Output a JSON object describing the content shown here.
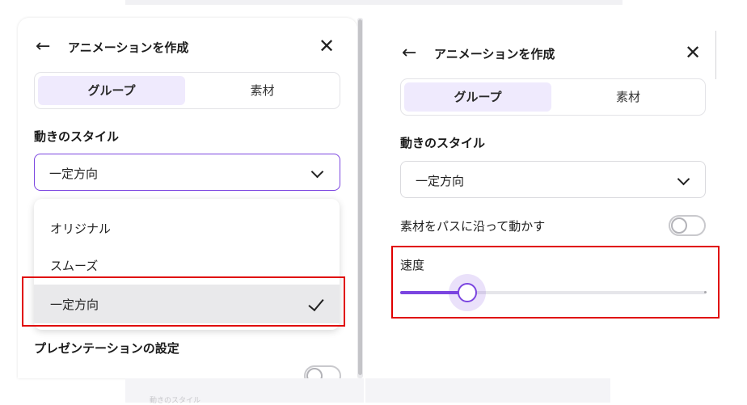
{
  "left_panel": {
    "header": {
      "back_icon": "arrow-left-icon",
      "title": "アニメーションを作成",
      "close_icon": "close-icon"
    },
    "tabs": [
      {
        "label": "グループ",
        "active": true
      },
      {
        "label": "素材",
        "active": false
      }
    ],
    "motion_style_label": "動きのスタイル",
    "select": {
      "value": "一定方向",
      "icon": "chevron-down-icon",
      "open": true
    },
    "dropdown_options": [
      {
        "label": "オリジナル",
        "selected": false
      },
      {
        "label": "スムーズ",
        "selected": false
      },
      {
        "label": "一定方向",
        "selected": true
      }
    ],
    "presentation_settings_label": "プレゼンテーションの設定"
  },
  "right_panel": {
    "header": {
      "back_icon": "arrow-left-icon",
      "title": "アニメーションを作成",
      "close_icon": "close-icon"
    },
    "tabs": [
      {
        "label": "グループ",
        "active": true
      },
      {
        "label": "素材",
        "active": false
      }
    ],
    "motion_style_label": "動きのスタイル",
    "select": {
      "value": "一定方向",
      "icon": "chevron-down-icon"
    },
    "path_toggle": {
      "label": "素材をパスに沿って動かす",
      "on": false
    },
    "speed": {
      "label": "速度",
      "value_fraction": 0.22
    }
  },
  "bottom_strip": {
    "ghost_text": "動きのスタイル"
  },
  "colors": {
    "accent": "#7b45e0",
    "tab_active_bg": "#efeafd",
    "highlight": "#e00000",
    "selected_row": "#e9e9eb"
  }
}
